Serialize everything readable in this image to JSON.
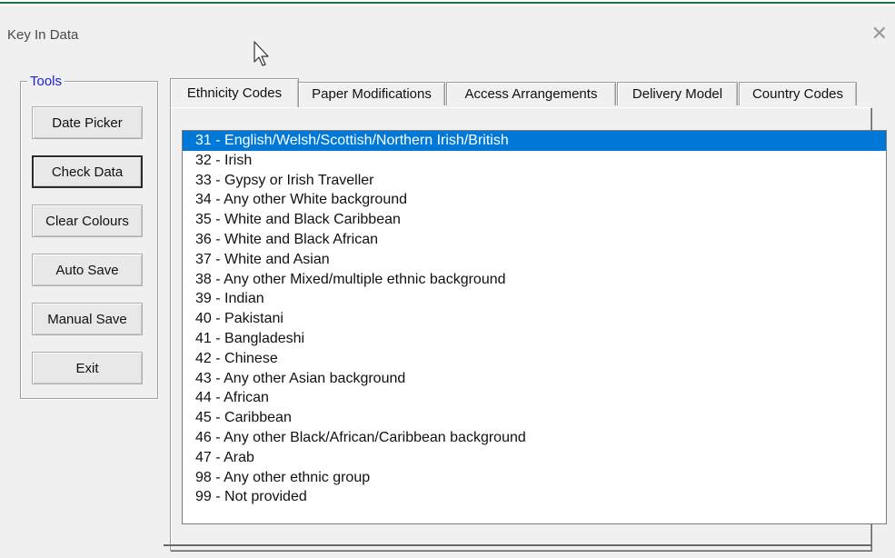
{
  "window": {
    "title": "Key In Data",
    "close_glyph": "✕"
  },
  "tools": {
    "legend": "Tools",
    "buttons": [
      {
        "label": "Date Picker"
      },
      {
        "label": "Check Data"
      },
      {
        "label": "Clear Colours"
      },
      {
        "label": "Auto Save"
      },
      {
        "label": "Manual Save"
      },
      {
        "label": "Exit"
      }
    ]
  },
  "tabs": [
    {
      "label": "Ethnicity Codes",
      "active": true
    },
    {
      "label": "Paper Modifications",
      "active": false
    },
    {
      "label": "Access Arrangements",
      "active": false
    },
    {
      "label": "Delivery Model",
      "active": false
    },
    {
      "label": "Country Codes",
      "active": false
    }
  ],
  "list": {
    "selected_index": 0,
    "items": [
      "31 - English/Welsh/Scottish/Northern Irish/British",
      "32 - Irish",
      "33 - Gypsy or Irish Traveller",
      "34 - Any other White background",
      "35 - White and Black Caribbean",
      "36 - White and Black African",
      "37 - White and Asian",
      "38 - Any other Mixed/multiple ethnic background",
      "39 - Indian",
      "40 - Pakistani",
      "41 - Bangladeshi",
      "42 - Chinese",
      "43 - Any other Asian background",
      "44 - African",
      "45 - Caribbean",
      "46 - Any other Black/African/Caribbean background",
      "47 - Arab",
      "98 - Any other ethnic group",
      "99 - Not provided"
    ]
  },
  "colors": {
    "selection": "#0078d7",
    "legend": "#1a22d8",
    "excel_green": "#217346"
  }
}
